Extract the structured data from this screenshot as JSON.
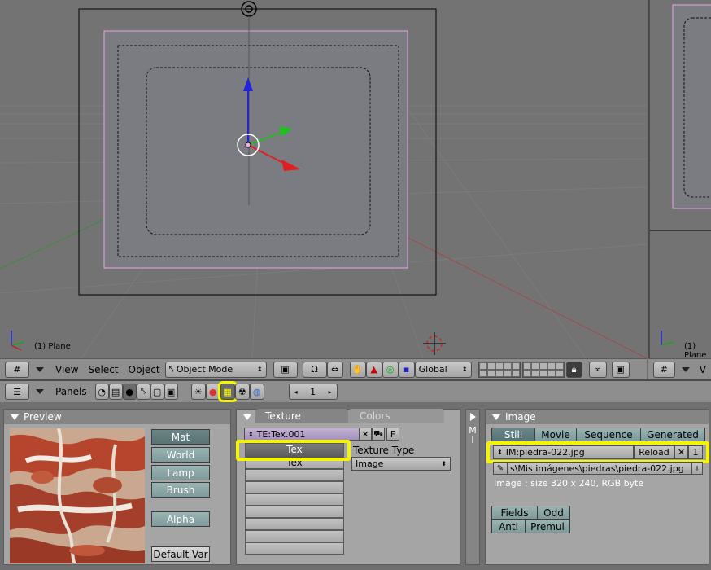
{
  "viewport": {
    "object_label": "(1) Plane",
    "object_label_right": "(1) Plane"
  },
  "header3d": {
    "menu_view": "View",
    "menu_select": "Select",
    "menu_object": "Object",
    "mode": "Object Mode",
    "orientation": "Global",
    "menu_view_right": "V"
  },
  "buttons_header": {
    "panels_label": "Panels",
    "frame_number": "1"
  },
  "preview_panel": {
    "title": "Preview",
    "buttons": [
      "Mat",
      "World",
      "Lamp",
      "Brush"
    ],
    "alpha": "Alpha",
    "default_var": "Default Var"
  },
  "texture_panel": {
    "tab_texture": "Texture",
    "tab_colors": "Colors",
    "texture_name": "TE:Tex.001",
    "f_button": "F",
    "x_button": "✕",
    "selected_slot": "Tex",
    "second_slot": "Tex",
    "texture_type_label": "Texture Type",
    "texture_type_value": "Image",
    "side_letters": "M\nI"
  },
  "image_panel": {
    "title": "Image",
    "tabs": [
      "Still",
      "Movie",
      "Sequence",
      "Generated"
    ],
    "image_name": "IM:piedra-022.jpg",
    "reload": "Reload",
    "x_button": "✕",
    "users": "1",
    "path": "s\\Mis imágenes\\piedras\\piedra-022.jpg",
    "info": "Image : size 320 x 240, RGB byte",
    "fields": "Fields",
    "odd": "Odd",
    "anti": "Anti",
    "premul": "Premul"
  }
}
